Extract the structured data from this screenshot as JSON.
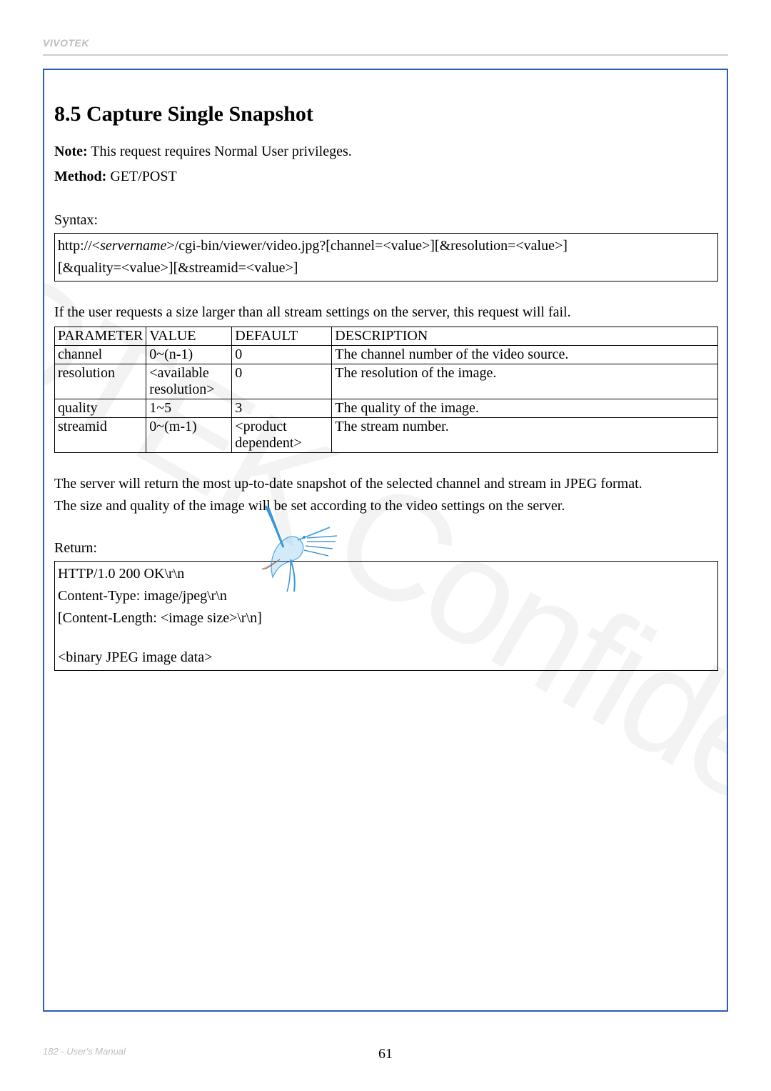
{
  "brand": "VIVOTEK",
  "watermark": "VIVOTEK Confidential",
  "section": {
    "title": "8.5 Capture Single Snapshot",
    "note_label": "Note:",
    "note_text": " This request requires Normal User privileges.",
    "method_label": "Method:",
    "method_text": " GET/POST",
    "syntax_label": "Syntax:",
    "syntax_prefix": "http://<",
    "syntax_servername": "servername",
    "syntax_rest": ">/cgi-bin/viewer/video.jpg?[channel=<value>][&resolution=<value>]",
    "syntax_line2": "[&quality=<value>][&streamid=<value>]",
    "pre_table_text": "If the user requests a size larger than all stream settings on the server, this request will fail.",
    "table": {
      "headers": [
        "PARAMETER",
        "VALUE",
        "DEFAULT",
        "DESCRIPTION"
      ],
      "rows": [
        {
          "param": "channel",
          "value": "0~(n-1)",
          "default": "0",
          "desc": "The channel number of the video source."
        },
        {
          "param": "resolution",
          "value": "<available resolution>",
          "default": "0",
          "desc": "The resolution of the image."
        },
        {
          "param": "quality",
          "value": "1~5",
          "default": "3",
          "desc": "The quality of the image."
        },
        {
          "param": "streamid",
          "value": "0~(m-1)",
          "default": "<product dependent>",
          "desc": "The stream number."
        }
      ]
    },
    "post_table_text1": "The server will return the most up-to-date snapshot of the selected channel and stream in JPEG format.",
    "post_table_text2": "The size and quality of the image will be set according to the video settings on the server.",
    "return_label": "Return:",
    "return_lines": [
      "HTTP/1.0 200 OK\\r\\n",
      "Content-Type: image/jpeg\\r\\n",
      "[Content-Length: <image size>\\r\\n]",
      "",
      "<binary JPEG image data>"
    ]
  },
  "footer": {
    "left": "182 - User's Manual",
    "center": "61"
  }
}
